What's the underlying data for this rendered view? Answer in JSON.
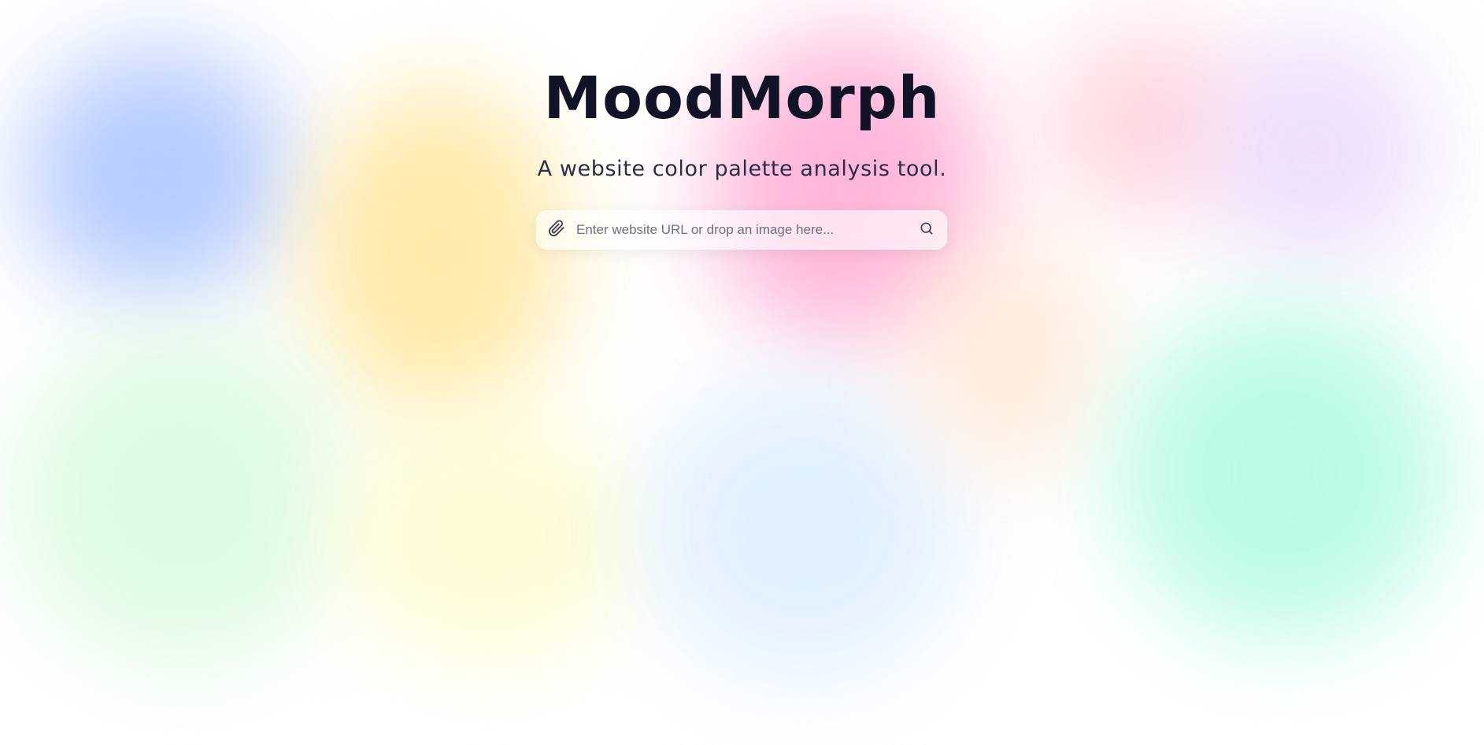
{
  "app": {
    "title": "MoodMorph",
    "subtitle": "A website color palette analysis tool."
  },
  "search": {
    "placeholder": "Enter website URL or drop an image here...",
    "value": "",
    "attach_icon": "paperclip-icon",
    "submit_icon": "search-icon"
  },
  "colors": {
    "title_text": "#111326",
    "subtitle_text": "#2b2f45",
    "background_blobs": [
      "#b3c9ff",
      "#ffe9a6",
      "#ffb3d9",
      "#ffd2da",
      "#eddcfb",
      "#dcfbe0",
      "#fefbd2",
      "#dff0ff",
      "#ffe8d4",
      "#b8fbe4"
    ]
  }
}
